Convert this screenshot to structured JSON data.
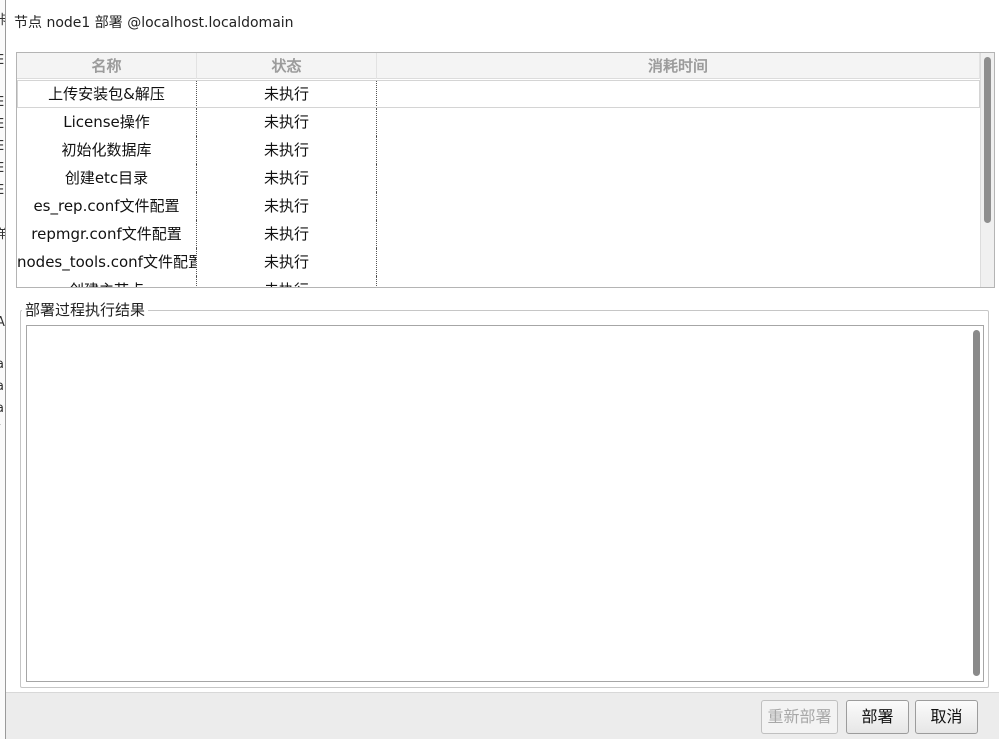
{
  "window": {
    "title": "节点 node1 部署 @localhost.localdomain"
  },
  "background_window": {
    "glyphs": [
      "卡",
      "E",
      "E",
      "E",
      "E",
      "E",
      "E",
      "羊",
      "A",
      "a",
      "a",
      "a",
      "/",
      "i"
    ]
  },
  "table": {
    "columns": [
      "名称",
      "状态",
      "消耗时间"
    ],
    "rows": [
      {
        "name": "上传安装包&解压",
        "status": "未执行",
        "duration": ""
      },
      {
        "name": "License操作",
        "status": "未执行",
        "duration": ""
      },
      {
        "name": "初始化数据库",
        "status": "未执行",
        "duration": ""
      },
      {
        "name": "创建etc目录",
        "status": "未执行",
        "duration": ""
      },
      {
        "name": "es_rep.conf文件配置",
        "status": "未执行",
        "duration": ""
      },
      {
        "name": "repmgr.conf文件配置",
        "status": "未执行",
        "duration": ""
      },
      {
        "name": "nodes_tools.conf文件配置",
        "status": "未执行",
        "duration": ""
      },
      {
        "name": "创建主节点",
        "status": "未执行",
        "duration": ""
      }
    ]
  },
  "result_group": {
    "label": "部署过程执行结果",
    "content": ""
  },
  "buttons": {
    "redeploy": "重新部署",
    "deploy": "部署",
    "cancel": "取消"
  },
  "colors": {
    "header_text": "#9c9c9c",
    "disabled_text": "#a8a8a8",
    "footer_bg": "#ececec"
  }
}
